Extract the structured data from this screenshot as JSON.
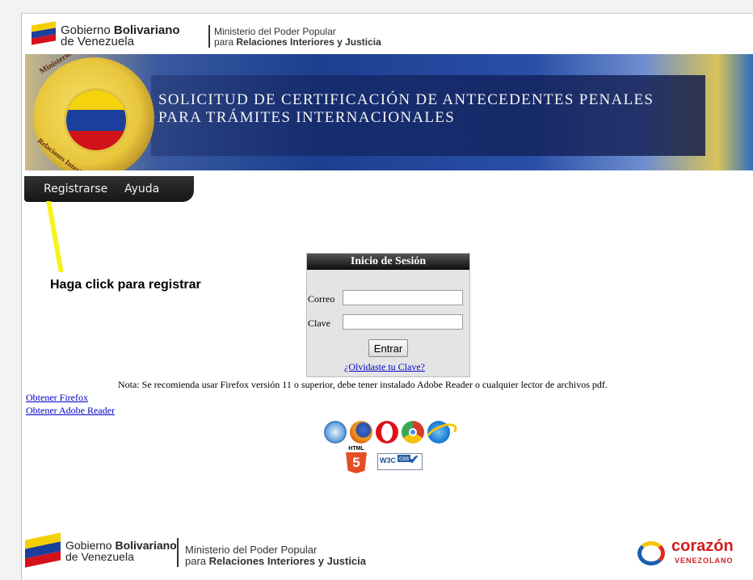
{
  "header": {
    "gob_line1_light": "Gobierno ",
    "gob_line1_bold": "Bolivariano",
    "gob_line2": "de Venezuela",
    "min_line1": "Ministerio del Poder Popular",
    "min_line2_light": "para ",
    "min_line2_bold": "Relaciones Interiores y Justicia"
  },
  "banner": {
    "title_line1": "SOLICITUD DE CERTIFICACIÓN DE ANTECEDENTES PENALES",
    "title_line2": "PARA TRÁMITES INTERNACIONALES",
    "seal_top": "Ministerio del Poder Popular",
    "seal_bottom": "Relaciones Interiores y Justicia"
  },
  "menu": {
    "register": "Registrarse",
    "help": "Ayuda"
  },
  "annotation": {
    "hint": "Haga click para registrar"
  },
  "login": {
    "title": "Inicio de Sesión",
    "email_label": "Correo",
    "email_value": "",
    "password_label": "Clave",
    "password_value": "",
    "submit_label": "Entrar",
    "forgot_link": "¿Olvidaste tu Clave?"
  },
  "note": "Nota: Se recomienda usar Firefox versión 11 o superior, debe tener instalado Adobe Reader o cualquier lector de archivos pdf.",
  "links": {
    "firefox": "Obtener Firefox",
    "adobe": "Obtener Adobe Reader"
  },
  "icons": [
    "safari-icon",
    "firefox-icon",
    "opera-icon",
    "chrome-icon",
    "ie-icon",
    "html5-icon",
    "w3c-css-icon"
  ],
  "badges": {
    "html5": "HTML",
    "html5_num": "5",
    "w3c": "W3C",
    "css": "css"
  },
  "footer": {
    "gob_line1_light": "Gobierno ",
    "gob_line1_bold": "Bolivariano",
    "gob_line2": "de Venezuela",
    "min_line1": "Ministerio del Poder Popular",
    "min_line2_light": "para ",
    "min_line2_bold": "Relaciones Interiores y Justicia",
    "corazon": "corazón",
    "venezolano": "VENEZOLANO"
  },
  "colors": {
    "menu_bg": "#1e201f",
    "link": "#0000cc",
    "pointer": "#f7f319",
    "flag_yellow": "#f5d000",
    "flag_blue": "#1a3f9a",
    "flag_red": "#d4111b"
  }
}
